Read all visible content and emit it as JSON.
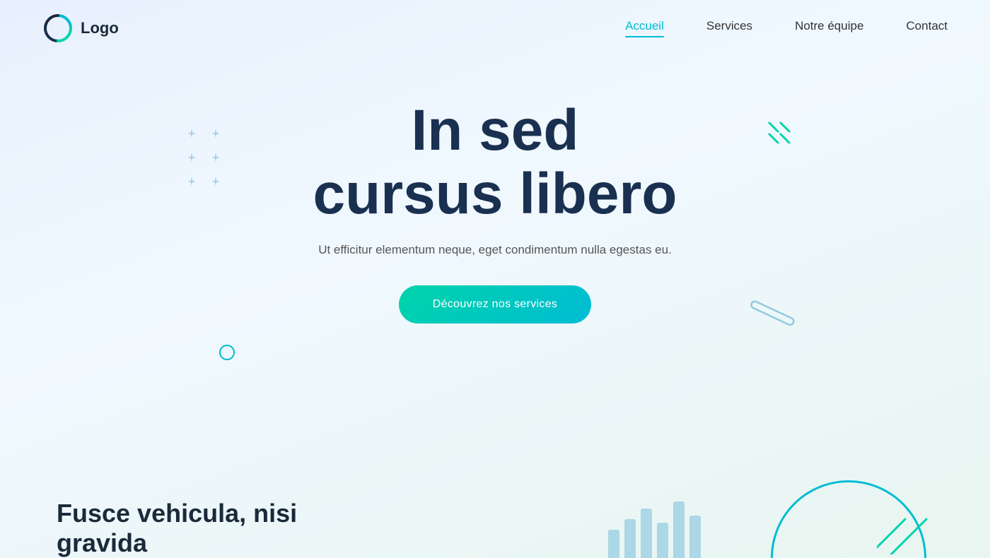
{
  "logo": {
    "text": "Logo"
  },
  "nav": {
    "links": [
      {
        "label": "Accueil",
        "active": true
      },
      {
        "label": "Services",
        "active": false
      },
      {
        "label": "Notre équipe",
        "active": false
      },
      {
        "label": "Contact",
        "active": false
      }
    ]
  },
  "hero": {
    "title_line1": "In sed",
    "title_line2": "cursus libero",
    "subtitle": "Ut efficitur elementum neque, eget condimentum nulla egestas eu.",
    "cta_label": "Découvrez nos services"
  },
  "below": {
    "title": "Fusce vehicula, nisi gravida"
  },
  "decorations": {
    "plus_symbol": "+",
    "x_symbol": "✕",
    "bars": [
      40,
      60,
      75,
      55,
      80,
      65
    ]
  }
}
